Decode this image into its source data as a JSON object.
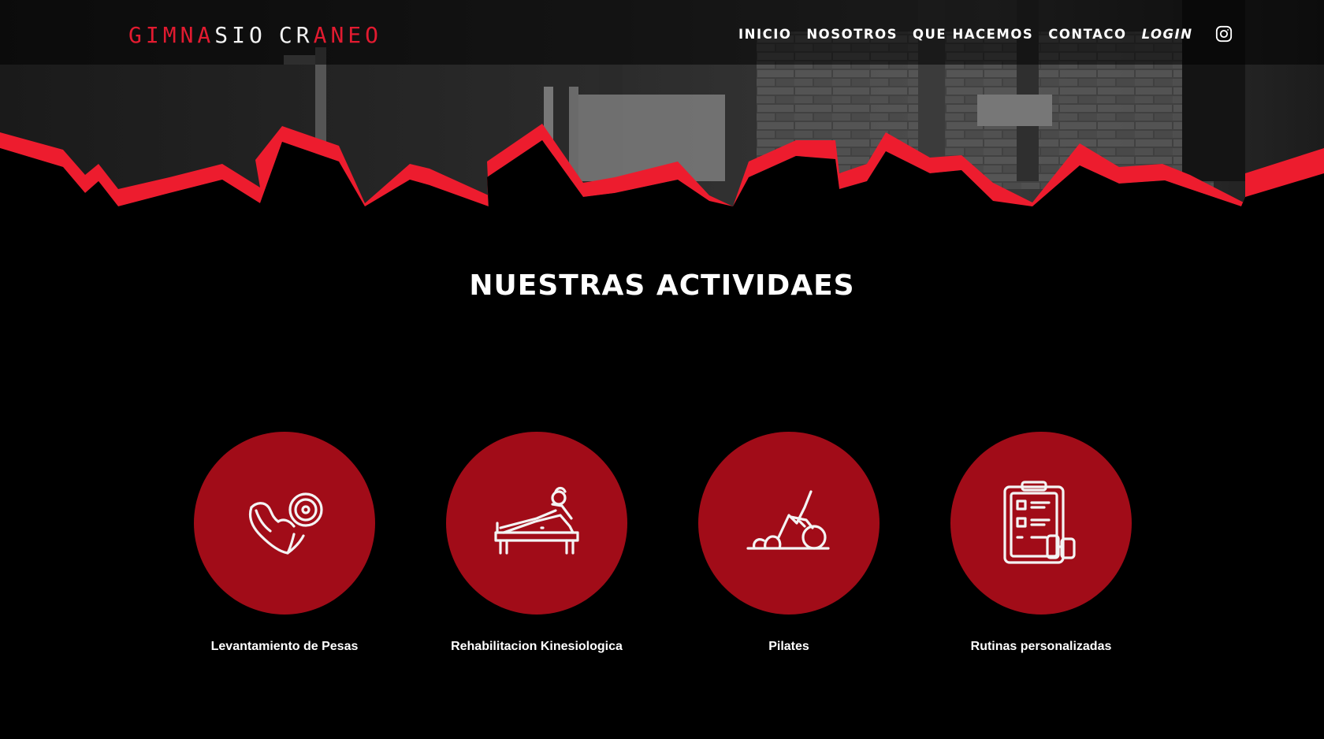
{
  "brand": {
    "logo_parts": [
      "GIMNA",
      "SIO",
      "CR",
      "A",
      "NEO"
    ],
    "accent_color": "#e21b30",
    "circle_color": "#a10c18"
  },
  "nav": {
    "items": [
      "INICIO",
      "NOSOTROS",
      "QUE HACEMOS",
      "CONTACO",
      "LOGIN"
    ],
    "social_icon": "instagram-icon"
  },
  "section": {
    "title": "NUESTRAS ACTIVIDAES"
  },
  "activities": [
    {
      "label": "Levantamiento de Pesas",
      "icon": "arm-dumbbell-icon"
    },
    {
      "label": "Rehabilitacion Kinesiologica",
      "icon": "rehab-table-icon"
    },
    {
      "label": "Pilates",
      "icon": "pilates-ball-icon"
    },
    {
      "label": "Rutinas personalizadas",
      "icon": "clipboard-routine-icon"
    }
  ]
}
